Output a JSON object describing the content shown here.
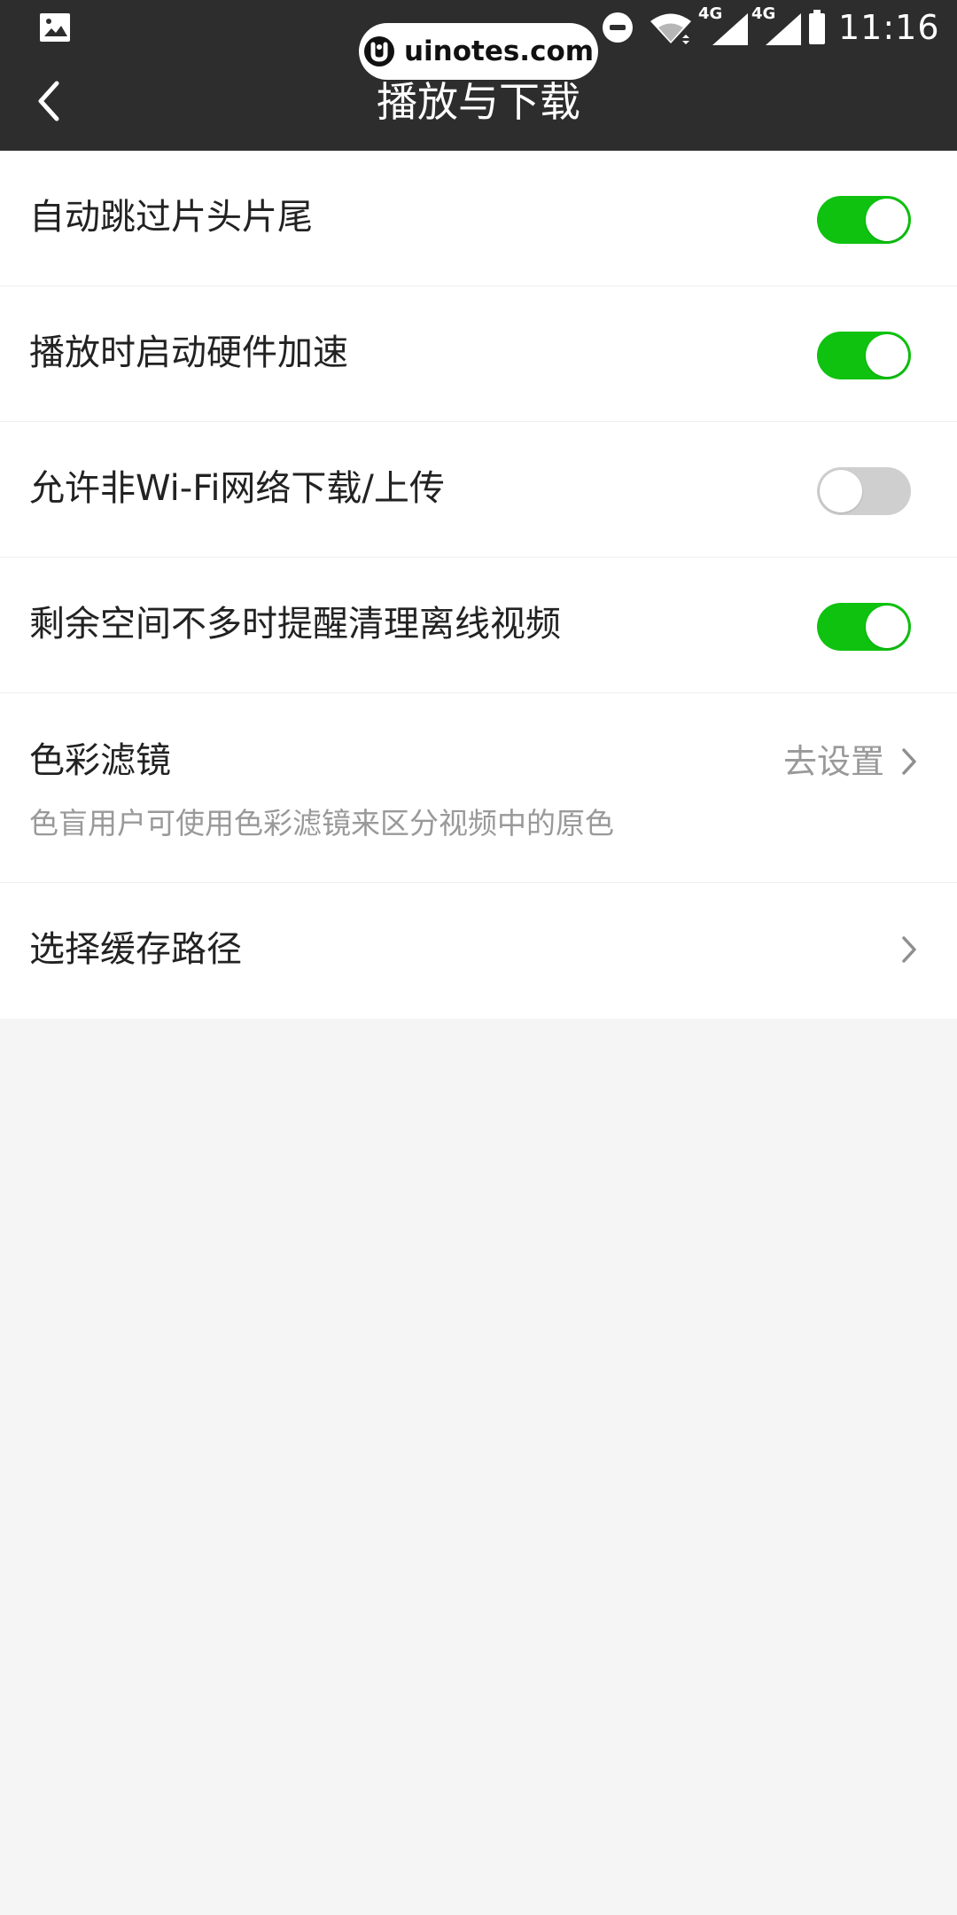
{
  "status_bar": {
    "network_1": "4G",
    "network_2": "4G",
    "time": "11:16"
  },
  "watermark": {
    "text": "uinotes.com"
  },
  "header": {
    "title": "播放与下载",
    "background": "#2d2d2d"
  },
  "settings": {
    "items": [
      {
        "label": "自动跳过片头片尾",
        "control": "toggle",
        "enabled": true
      },
      {
        "label": "播放时启动硬件加速",
        "control": "toggle",
        "enabled": true
      },
      {
        "label": "允许非Wi-Fi网络下载/上传",
        "control": "toggle",
        "enabled": false
      },
      {
        "label": "剩余空间不多时提醒清理离线视频",
        "control": "toggle",
        "enabled": true
      },
      {
        "label": "色彩滤镜",
        "description": "色盲用户可使用色彩滤镜来区分视频中的原色",
        "action": "去设置",
        "control": "chevron-right-icon"
      },
      {
        "label": "选择缓存路径",
        "control": "chevron-right-icon"
      }
    ]
  },
  "colors": {
    "toggle_on": "#0ec20f",
    "toggle_off": "#cfcfcf",
    "muted_text": "#999999",
    "page_background": "#f5f5f5"
  },
  "icons": {
    "back": "chevron-left-icon",
    "disclosure": "chevron-right-icon",
    "gallery": "gallery-icon",
    "do_not_disturb": "do-not-disturb-icon",
    "wifi": "wifi-icon",
    "signal": "signal-icon",
    "battery": "battery-icon",
    "watermark_logo": "uinotes-logo-icon"
  }
}
